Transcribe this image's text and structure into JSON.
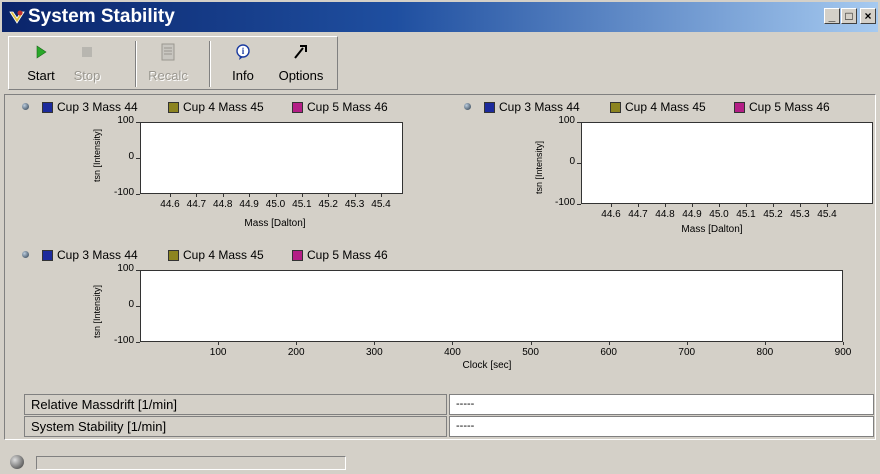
{
  "window": {
    "title": "System Stability",
    "icon": "app-icon"
  },
  "toolbar": {
    "buttons": [
      {
        "label": "Start",
        "icon": "play-icon",
        "enabled": true
      },
      {
        "label": "Stop",
        "icon": "stop-icon",
        "enabled": false
      },
      {
        "label": "Recalc",
        "icon": "recalc-icon",
        "enabled": false
      },
      {
        "label": "Info",
        "icon": "info-icon",
        "enabled": true
      },
      {
        "label": "Options",
        "icon": "options-icon",
        "enabled": true
      }
    ]
  },
  "legend": {
    "items": [
      {
        "label": "Cup 3 Mass 44",
        "color": "#1c2a9c"
      },
      {
        "label": "Cup 4 Mass 45",
        "color": "#8c8420"
      },
      {
        "label": "Cup 5 Mass 46",
        "color": "#b41e86"
      }
    ]
  },
  "chart_data": [
    {
      "type": "line",
      "ylabel": "tsn [Intensity]",
      "xlabel": "Mass [Dalton]",
      "yticks": [
        "100",
        "0",
        "-100"
      ],
      "xticks": [
        "44.6",
        "44.7",
        "44.8",
        "44.9",
        "45.0",
        "45.1",
        "45.2",
        "45.3",
        "45.4"
      ],
      "ylim": [
        -100,
        100
      ],
      "series": []
    },
    {
      "type": "line",
      "ylabel": "tsn [Intensity]",
      "xlabel": "Mass [Dalton]",
      "yticks": [
        "100",
        "0",
        "-100"
      ],
      "xticks": [
        "44.6",
        "44.7",
        "44.8",
        "44.9",
        "45.0",
        "45.1",
        "45.2",
        "45.3",
        "45.4"
      ],
      "ylim": [
        -100,
        100
      ],
      "series": []
    },
    {
      "type": "line",
      "ylabel": "tsn [Intensity]",
      "xlabel": "Clock [sec]",
      "yticks": [
        "100",
        "0",
        "-100"
      ],
      "xticks": [
        "100",
        "200",
        "300",
        "400",
        "500",
        "600",
        "700",
        "800",
        "900"
      ],
      "ylim": [
        -100,
        100
      ],
      "xlim": [
        0,
        900
      ],
      "series": []
    }
  ],
  "results": {
    "rows": [
      {
        "label": "Relative Massdrift [1/min]",
        "value": "-----"
      },
      {
        "label": "System Stability [1/min]",
        "value": "-----"
      }
    ]
  },
  "statusbar": {
    "progress": 0
  }
}
